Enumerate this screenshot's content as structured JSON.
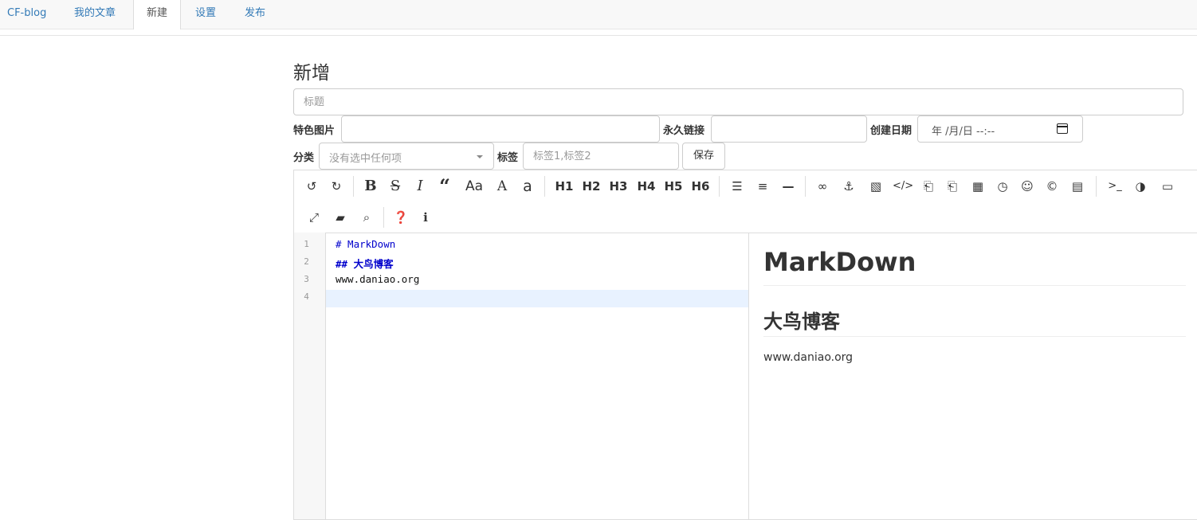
{
  "nav": {
    "tabs": [
      {
        "label": "CF-blog"
      },
      {
        "label": "我的文章"
      },
      {
        "label": "新建"
      },
      {
        "label": "设置"
      },
      {
        "label": "发布"
      }
    ],
    "active_index": 2
  },
  "form": {
    "page_title": "新增",
    "title_placeholder": "标题",
    "featured_image_label": "特色图片",
    "permalink_label": "永久链接",
    "created_date_label": "创建日期",
    "date_placeholder": "年 /月/日 --:--",
    "category_label": "分类",
    "category_placeholder": "没有选中任何项",
    "tags_label": "标签",
    "tags_placeholder": "标签1,标签2",
    "save_label": "保存"
  },
  "toolbar": {
    "headings": [
      "H1",
      "H2",
      "H3",
      "H4",
      "H5",
      "H6"
    ],
    "case_upper": "Aa",
    "case_a": "A",
    "case_lower": "a"
  },
  "editor": {
    "line_numbers": [
      "1",
      "2",
      "3",
      "4"
    ],
    "lines": [
      "# MarkDown",
      "## 大鸟博客",
      "www.daniao.org",
      ""
    ]
  },
  "preview": {
    "h1": "MarkDown",
    "h2": "大鸟博客",
    "p": "www.daniao.org"
  },
  "colors": {
    "link": "#337ab7",
    "active_line": "#e8f2ff",
    "markdown_heading": "#0000cc"
  }
}
